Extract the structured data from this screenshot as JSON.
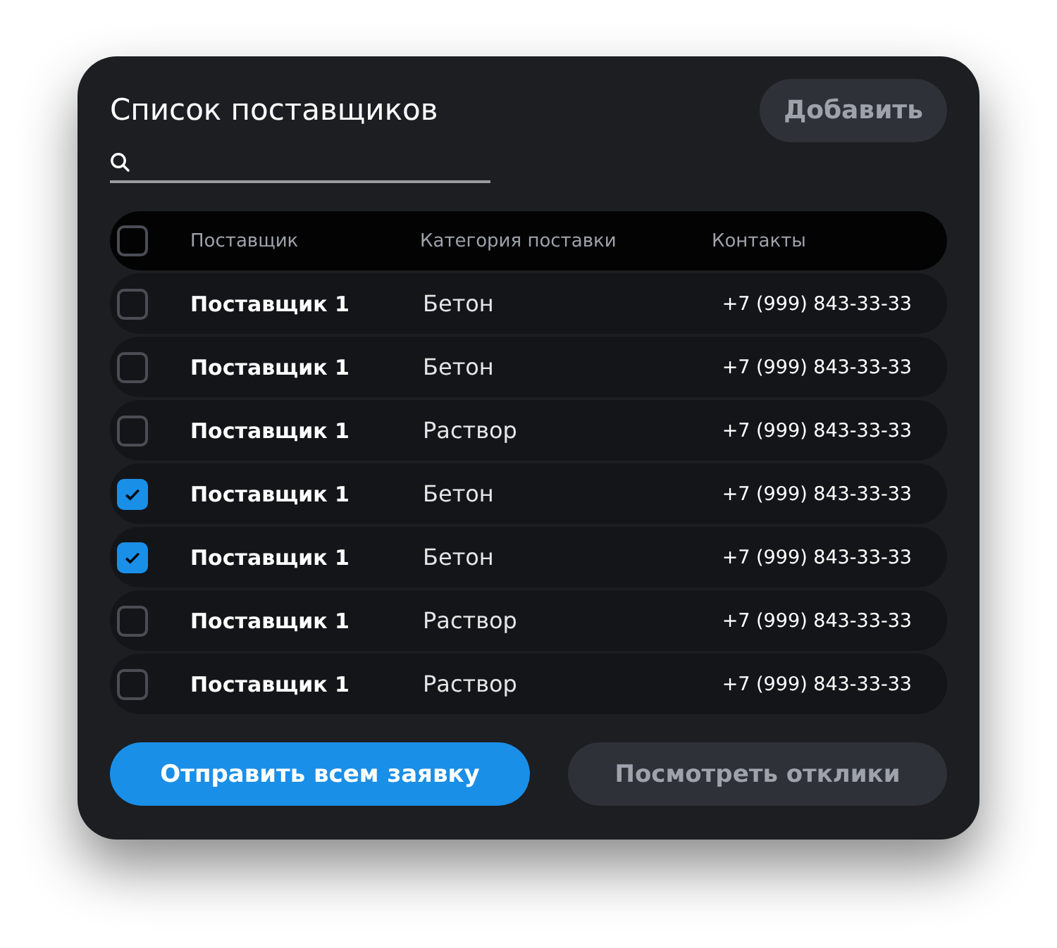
{
  "title": "Список поставщиков",
  "add_button": "Добавить",
  "table": {
    "header_checked": false,
    "columns": [
      "Поставщик",
      "Категория поставки",
      "Контакты"
    ],
    "rows": [
      {
        "supplier": "Поставщик 1",
        "category": "Бетон",
        "contact": "+7 (999) 843-33-33",
        "checked": false
      },
      {
        "supplier": "Поставщик 1",
        "category": "Бетон",
        "contact": "+7 (999) 843-33-33",
        "checked": false
      },
      {
        "supplier": "Поставщик 1",
        "category": "Раствор",
        "contact": "+7 (999) 843-33-33",
        "checked": false
      },
      {
        "supplier": "Поставщик 1",
        "category": "Бетон",
        "contact": "+7 (999) 843-33-33",
        "checked": true
      },
      {
        "supplier": "Поставщик 1",
        "category": "Бетон",
        "contact": "+7 (999) 843-33-33",
        "checked": true
      },
      {
        "supplier": "Поставщик 1",
        "category": "Раствор",
        "contact": "+7 (999) 843-33-33",
        "checked": false
      },
      {
        "supplier": "Поставщик 1",
        "category": "Раствор",
        "contact": "+7 (999) 843-33-33",
        "checked": false
      }
    ]
  },
  "buttons": [
    {
      "label": "Отправить всем заявку",
      "kind": "primary"
    },
    {
      "label": "Посмотреть отклики",
      "kind": "secondary"
    }
  ]
}
